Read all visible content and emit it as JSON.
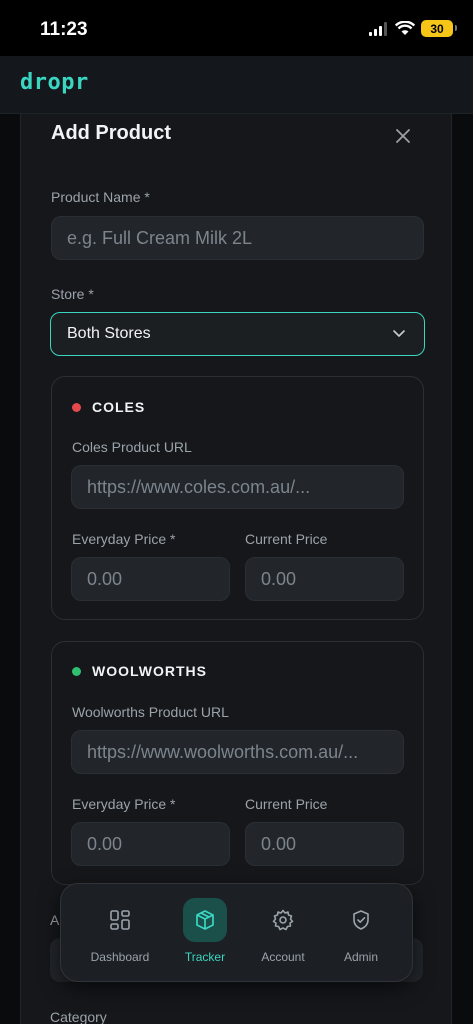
{
  "status_bar": {
    "time": "11:23",
    "battery": "30"
  },
  "header": {
    "logo": "dropr"
  },
  "modal": {
    "title": "Add Product",
    "product_name": {
      "label": "Product Name *",
      "placeholder": "e.g. Full Cream Milk 2L"
    },
    "store": {
      "label": "Store *",
      "value": "Both Stores"
    },
    "coles": {
      "name": "COLES",
      "dot_color": "#e5484d",
      "url_label": "Coles Product URL",
      "url_placeholder": "https://www.coles.com.au/...",
      "everyday_label": "Everyday Price *",
      "everyday_placeholder": "0.00",
      "current_label": "Current Price",
      "current_placeholder": "0.00"
    },
    "woolworths": {
      "name": "WOOLWORTHS",
      "dot_color": "#2fbf71",
      "url_label": "Woolworths Product URL",
      "url_placeholder": "https://www.woolworths.com.au/...",
      "everyday_label": "Everyday Price *",
      "everyday_placeholder": "0.00",
      "current_label": "Current Price",
      "current_placeholder": "0.00"
    },
    "behind_label": "A",
    "category_label": "Category"
  },
  "nav": {
    "items": [
      {
        "label": "Dashboard",
        "icon": "dashboard-icon"
      },
      {
        "label": "Tracker",
        "icon": "box-icon",
        "active": true
      },
      {
        "label": "Account",
        "icon": "gear-icon"
      },
      {
        "label": "Admin",
        "icon": "shield-icon"
      }
    ]
  },
  "colors": {
    "accent": "#3ad6c2",
    "background": "#15171a"
  }
}
